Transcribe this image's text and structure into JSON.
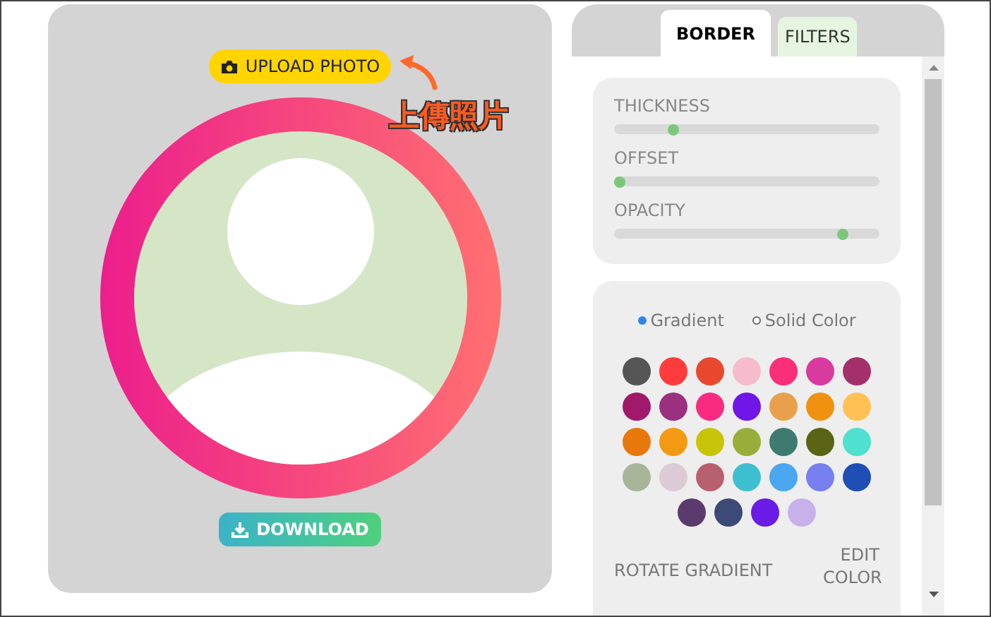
{
  "upload_button": {
    "label": "UPLOAD PHOTO"
  },
  "annotation": {
    "text": "上傳照片"
  },
  "download_button": {
    "label": "DOWNLOAD"
  },
  "tabs": [
    {
      "label": "BORDER",
      "selected": true
    },
    {
      "label": "FILTERS",
      "selected": false
    }
  ],
  "sliders": [
    {
      "label": "THICKNESS",
      "level": 0.21
    },
    {
      "label": "OFFSET",
      "level": 0.0
    },
    {
      "label": "OPACITY",
      "level": 0.88
    }
  ],
  "fill_modes": [
    {
      "label": "Gradient",
      "selected": true
    },
    {
      "label": "Solid Color",
      "selected": false
    }
  ],
  "swatches": [
    {
      "color": "#555555"
    },
    {
      "color": "#ff3b3b"
    },
    {
      "color": "#e8492e"
    },
    {
      "color": "#f7bccb"
    },
    {
      "color": "#fb2e7a"
    },
    {
      "color": "#d83aa0"
    },
    {
      "color": "#a3306b"
    },
    {
      "color": "#a1196b"
    },
    {
      "color": "#9b2f80"
    },
    {
      "color": "#f92b7f"
    },
    {
      "color": "#7016e8"
    },
    {
      "color": "#e9a04d"
    },
    {
      "color": "#f0920f"
    },
    {
      "color": "#ffc154"
    },
    {
      "color": "#e8780c"
    },
    {
      "color": "#f39a12"
    },
    {
      "color": "#c7c40a"
    },
    {
      "color": "#99ad3b"
    },
    {
      "color": "#3f7a70"
    },
    {
      "color": "#5a6414"
    },
    {
      "color": "#4fe0cf"
    },
    {
      "color": "#a8b598"
    },
    {
      "color": "#dccad6"
    },
    {
      "color": "#b8616e"
    },
    {
      "color": "#3ebfcf"
    },
    {
      "color": "#4aa7f0"
    },
    {
      "color": "#7680ee"
    },
    {
      "color": "#1f4fb5"
    },
    {
      "color": "#5b3b6e"
    },
    {
      "color": "#3d4a78"
    },
    {
      "color": "#6a1be6"
    },
    {
      "color": "#c8b0ea"
    }
  ],
  "rotate_gradient": {
    "label": "ROTATE GRADIENT"
  },
  "edit_color": {
    "label": "EDIT COLOR"
  }
}
